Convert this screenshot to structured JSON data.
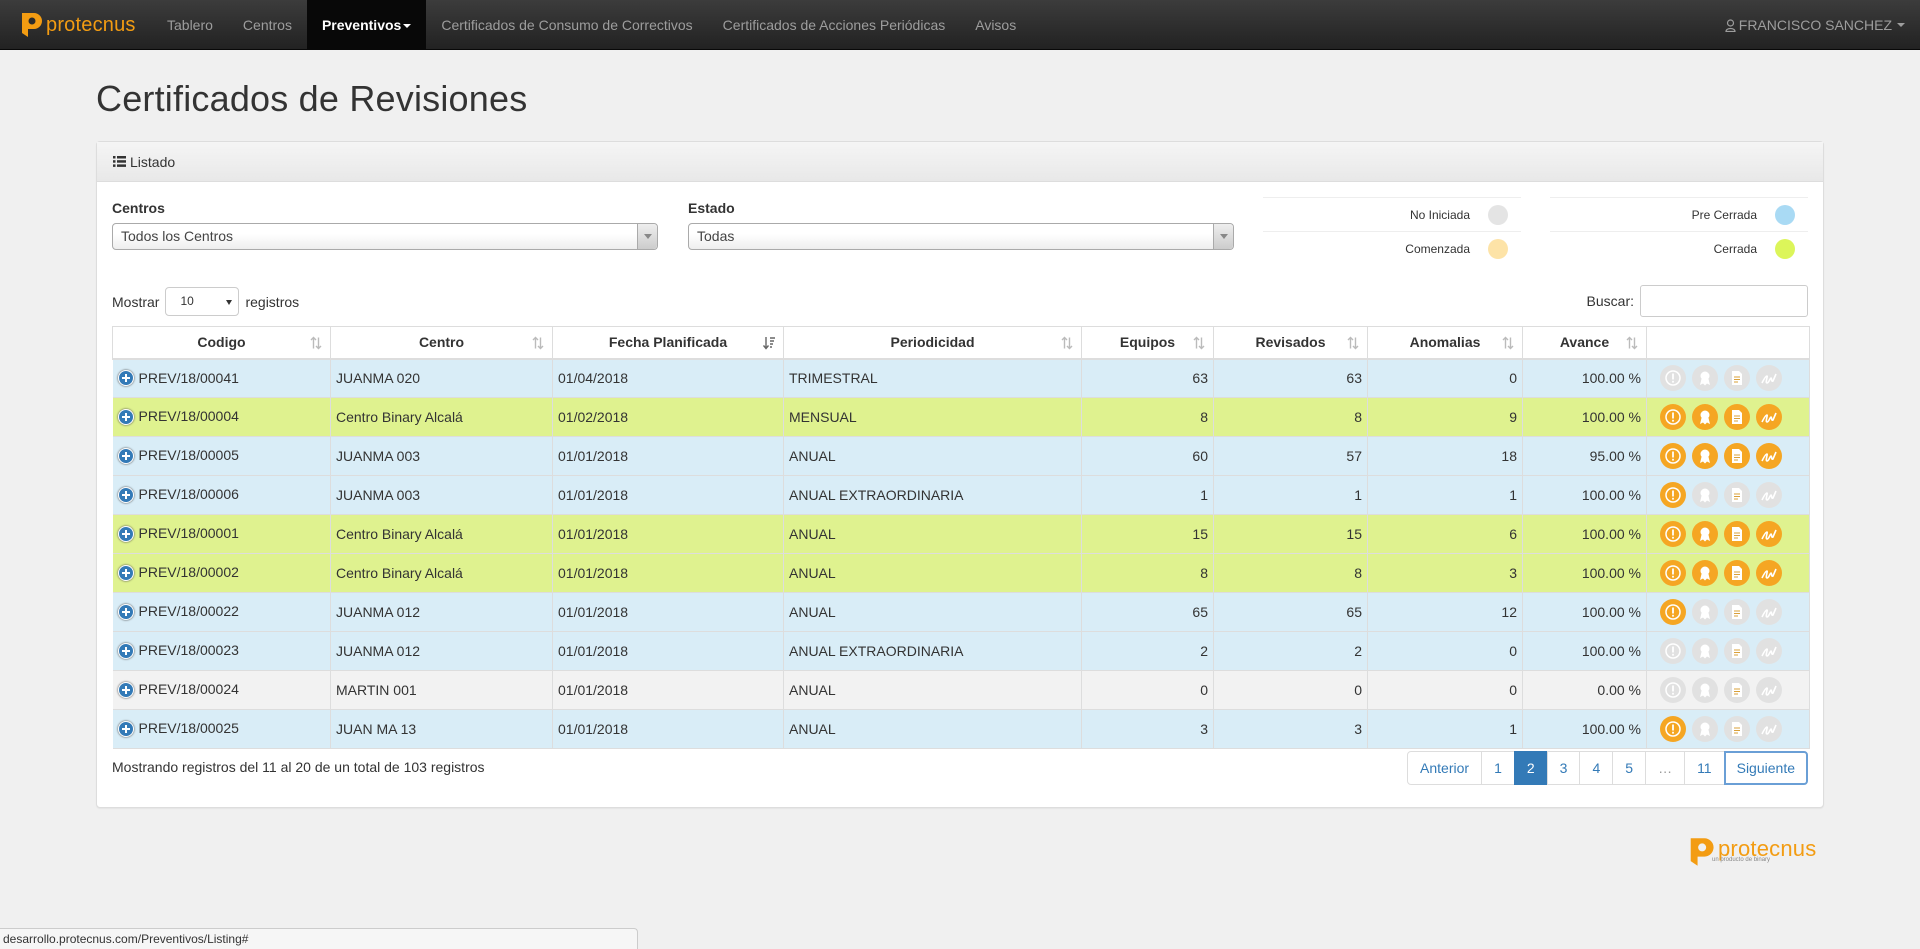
{
  "brand": {
    "name": "protecnus",
    "tagline": "un producto de binary"
  },
  "nav": {
    "items": [
      {
        "label": "Tablero"
      },
      {
        "label": "Centros"
      },
      {
        "label": "Preventivos",
        "active": true
      },
      {
        "label": "Certificados de Consumo de Correctivos"
      },
      {
        "label": "Certificados de Acciones Periódicas"
      },
      {
        "label": "Avisos"
      }
    ],
    "user": "FRANCISCO SANCHEZ"
  },
  "page": {
    "title": "Certificados de Revisiones"
  },
  "panel": {
    "heading": "Listado"
  },
  "filters": {
    "centros_label": "Centros",
    "centros_value": "Todos los Centros",
    "estado_label": "Estado",
    "estado_value": "Todas"
  },
  "legend": [
    {
      "label": "No Iniciada",
      "color": "#e4e4e4"
    },
    {
      "label": "Comenzada",
      "color": "#fde3a7"
    },
    {
      "label": "Pre Cerrada",
      "color": "#a9daf4"
    },
    {
      "label": "Cerrada",
      "color": "#dcf55a"
    }
  ],
  "length": {
    "prefix": "Mostrar",
    "value": "10",
    "suffix": "registros"
  },
  "search": {
    "label": "Buscar:",
    "value": ""
  },
  "table": {
    "columns": [
      "Codigo",
      "Centro",
      "Fecha Planificada",
      "Periodicidad",
      "Equipos",
      "Revisados",
      "Anomalias",
      "Avance",
      ""
    ],
    "rows": [
      {
        "codigo": "PREV/18/00041",
        "centro": "JUANMA 020",
        "fecha": "01/04/2018",
        "periodicidad": "TRIMESTRAL",
        "equipos": "63",
        "revisados": "63",
        "anomalias": "0",
        "avance": "100.00 %",
        "status": "blue",
        "actions": [
          false,
          false,
          false,
          false
        ]
      },
      {
        "codigo": "PREV/18/00004",
        "centro": "Centro Binary Alcalá",
        "fecha": "01/02/2018",
        "periodicidad": "MENSUAL",
        "equipos": "8",
        "revisados": "8",
        "anomalias": "9",
        "avance": "100.00 %",
        "status": "yellow",
        "actions": [
          true,
          true,
          true,
          true
        ]
      },
      {
        "codigo": "PREV/18/00005",
        "centro": "JUANMA 003",
        "fecha": "01/01/2018",
        "periodicidad": "ANUAL",
        "equipos": "60",
        "revisados": "57",
        "anomalias": "18",
        "avance": "95.00 %",
        "status": "blue",
        "actions": [
          true,
          true,
          true,
          true
        ]
      },
      {
        "codigo": "PREV/18/00006",
        "centro": "JUANMA 003",
        "fecha": "01/01/2018",
        "periodicidad": "ANUAL EXTRAORDINARIA",
        "equipos": "1",
        "revisados": "1",
        "anomalias": "1",
        "avance": "100.00 %",
        "status": "blue",
        "actions": [
          true,
          false,
          false,
          false
        ]
      },
      {
        "codigo": "PREV/18/00001",
        "centro": "Centro Binary Alcalá",
        "fecha": "01/01/2018",
        "periodicidad": "ANUAL",
        "equipos": "15",
        "revisados": "15",
        "anomalias": "6",
        "avance": "100.00 %",
        "status": "yellow",
        "actions": [
          true,
          true,
          true,
          true
        ]
      },
      {
        "codigo": "PREV/18/00002",
        "centro": "Centro Binary Alcalá",
        "fecha": "01/01/2018",
        "periodicidad": "ANUAL",
        "equipos": "8",
        "revisados": "8",
        "anomalias": "3",
        "avance": "100.00 %",
        "status": "yellow",
        "actions": [
          true,
          true,
          true,
          true
        ]
      },
      {
        "codigo": "PREV/18/00022",
        "centro": "JUANMA 012",
        "fecha": "01/01/2018",
        "periodicidad": "ANUAL",
        "equipos": "65",
        "revisados": "65",
        "anomalias": "12",
        "avance": "100.00 %",
        "status": "blue",
        "actions": [
          true,
          false,
          false,
          false
        ]
      },
      {
        "codigo": "PREV/18/00023",
        "centro": "JUANMA 012",
        "fecha": "01/01/2018",
        "periodicidad": "ANUAL EXTRAORDINARIA",
        "equipos": "2",
        "revisados": "2",
        "anomalias": "0",
        "avance": "100.00 %",
        "status": "blue",
        "actions": [
          false,
          false,
          false,
          false
        ]
      },
      {
        "codigo": "PREV/18/00024",
        "centro": "MARTIN 001",
        "fecha": "01/01/2018",
        "periodicidad": "ANUAL",
        "equipos": "0",
        "revisados": "0",
        "anomalias": "0",
        "avance": "0.00 %",
        "status": "gray",
        "actions": [
          false,
          false,
          false,
          false
        ]
      },
      {
        "codigo": "PREV/18/00025",
        "centro": "JUAN MA 13",
        "fecha": "01/01/2018",
        "periodicidad": "ANUAL",
        "equipos": "3",
        "revisados": "3",
        "anomalias": "1",
        "avance": "100.00 %",
        "status": "blue",
        "actions": [
          true,
          false,
          false,
          false
        ]
      }
    ]
  },
  "info": "Mostrando registros del 11 al 20 de un total de 103 registros",
  "pagination": {
    "items": [
      {
        "label": "Anterior",
        "kind": "prev"
      },
      {
        "label": "1"
      },
      {
        "label": "2",
        "active": true
      },
      {
        "label": "3"
      },
      {
        "label": "4"
      },
      {
        "label": "5"
      },
      {
        "label": "…",
        "disabled": true
      },
      {
        "label": "11"
      },
      {
        "label": "Siguiente",
        "kind": "next"
      }
    ]
  },
  "statusbar": "desarrollo.protecnus.com/Preventivos/Listing#"
}
